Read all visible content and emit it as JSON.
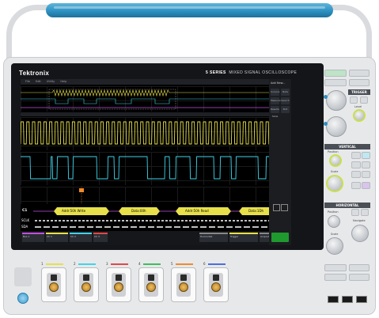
{
  "device": {
    "brand": "Tektronix",
    "series_prefix": "5 SERIES",
    "series_suffix": "MIXED SIGNAL OSCILLOSCOPE"
  },
  "menu": [
    "File",
    "Edit",
    "Utility",
    "Help"
  ],
  "sidepanel": {
    "title": "Add New...",
    "buttons": [
      "Cursors",
      "Note",
      "Measure",
      "Search",
      "Results Table",
      "Plot"
    ]
  },
  "channels": {
    "c1": "C1",
    "sclk": "SCLK",
    "sda": "SDA"
  },
  "bus_packets": [
    "Addr:50h Write",
    "Data:00h",
    "Addr:50h Read",
    "Data:1Dh"
  ],
  "bottom_badges": [
    "Bus 1",
    "Ch 1",
    "Ch 2",
    "Ch 3",
    "Horizontal",
    "Trigger",
    "Acquisition"
  ],
  "panel": {
    "trigger": "TRIGGER",
    "level": "Level",
    "vertical": "VERTICAL",
    "position": "Position",
    "scale": "Scale",
    "horizontal": "HORIZONTAL",
    "h_position": "Position",
    "h_scale": "Scale",
    "navigate": "Navigate"
  },
  "probe_channels": [
    "1",
    "2",
    "3",
    "4",
    "5",
    "6"
  ],
  "colors": {
    "ch1": "#e8e04a",
    "ch2": "#3fd4ea",
    "ch3": "#e04848",
    "ch4": "#3fbf5a",
    "ch5": "#f08a2a",
    "ch6": "#4a6ee0",
    "bus": "#e8e04a"
  }
}
